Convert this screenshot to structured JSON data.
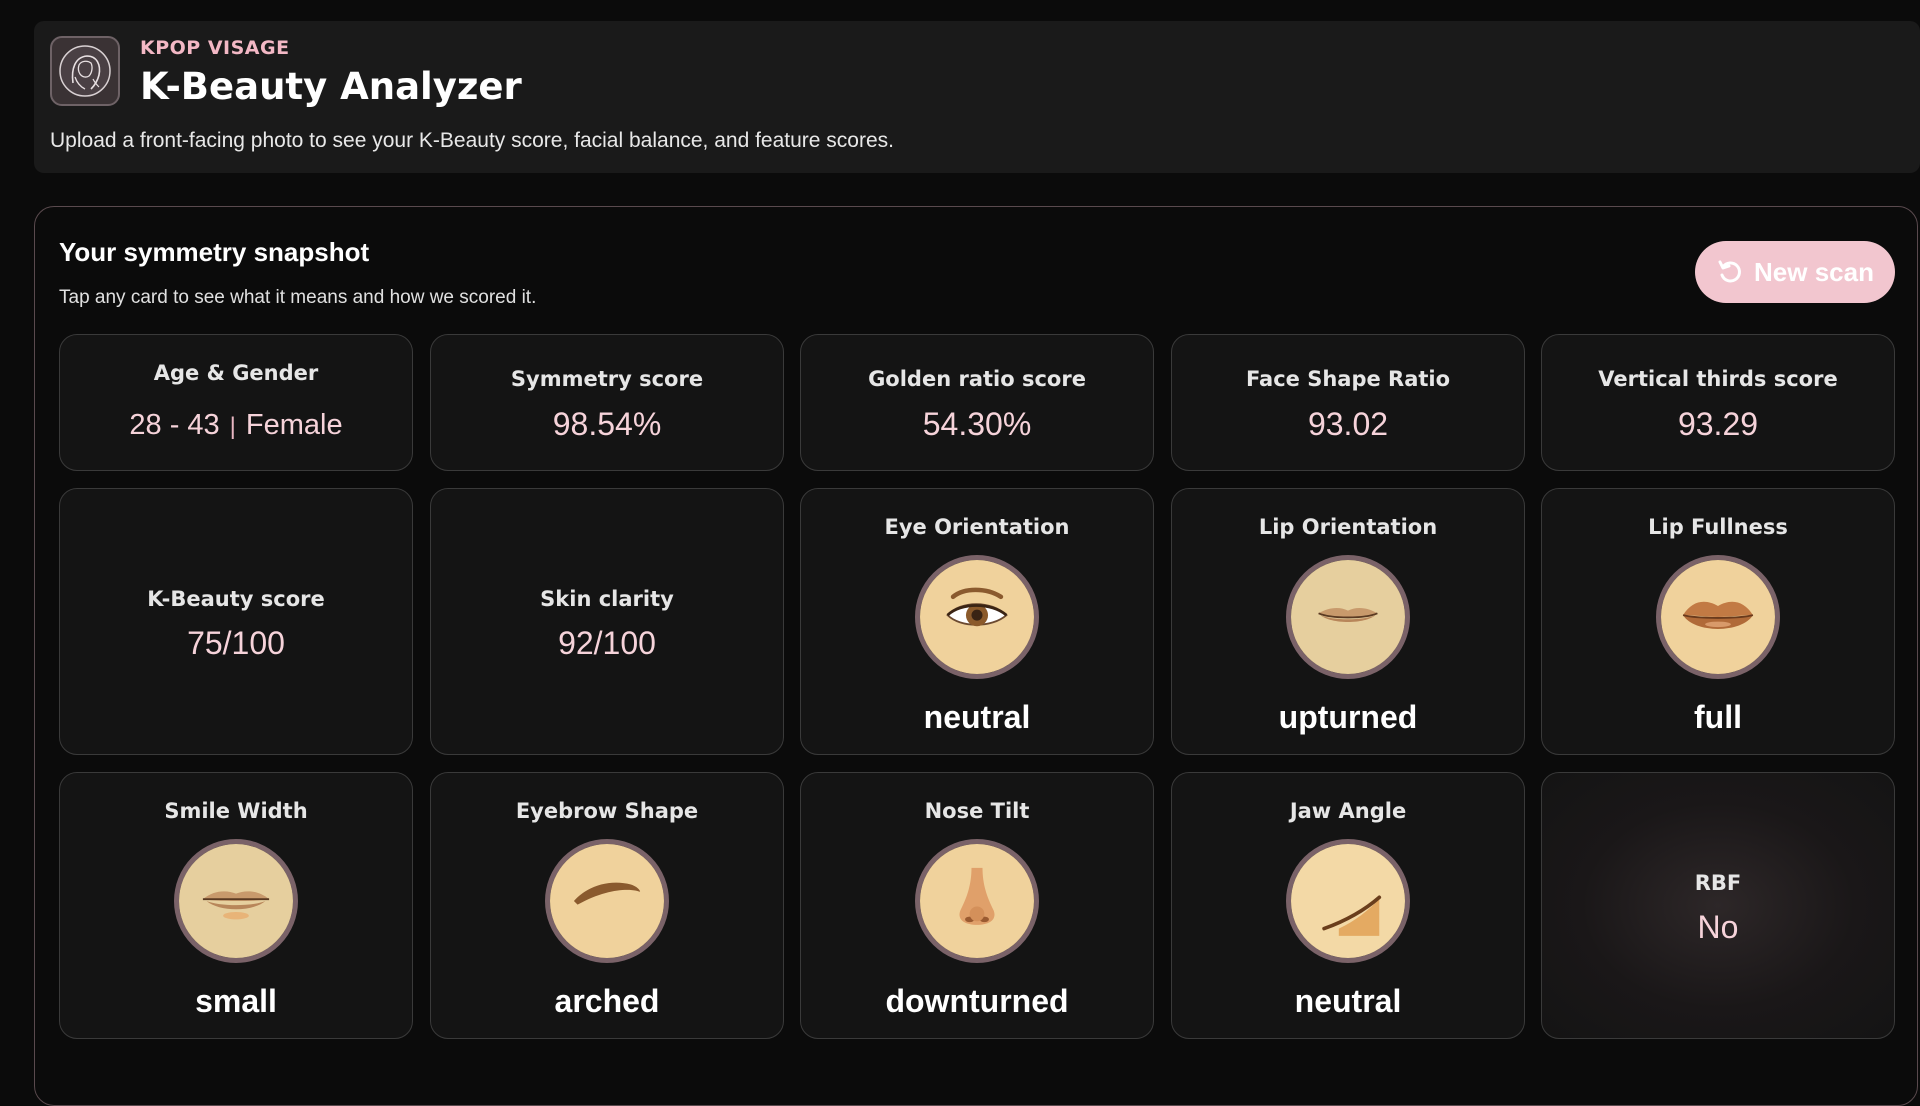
{
  "header": {
    "brand": "KPOP VISAGE",
    "title": "K-Beauty Analyzer",
    "tagline": "Upload a front-facing photo to see your K-Beauty score, facial balance, and feature scores.",
    "logo_icon": "woman-portrait-icon"
  },
  "snapshot": {
    "title": "Your symmetry snapshot",
    "subtitle": "Tap any card to see what it means and how we scored it.",
    "new_scan_label": "New scan",
    "new_scan_icon": "refresh-icon"
  },
  "cards": {
    "age_gender": {
      "label": "Age & Gender",
      "age": "28 - 43",
      "separator": "|",
      "gender": "Female"
    },
    "symmetry": {
      "label": "Symmetry score",
      "value": "98.54%"
    },
    "golden_ratio": {
      "label": "Golden ratio score",
      "value": "54.30%"
    },
    "face_shape": {
      "label": "Face Shape Ratio",
      "value": "93.02"
    },
    "vertical_thirds": {
      "label": "Vertical thirds score",
      "value": "93.29"
    },
    "kbeauty": {
      "label": "K-Beauty score",
      "value": "75/100"
    },
    "skin_clarity": {
      "label": "Skin clarity",
      "value": "92/100"
    },
    "eye_orientation": {
      "label": "Eye Orientation",
      "value": "neutral",
      "icon": "eye-icon"
    },
    "lip_orientation": {
      "label": "Lip Orientation",
      "value": "upturned",
      "icon": "lips-upturned-icon"
    },
    "lip_fullness": {
      "label": "Lip Fullness",
      "value": "full",
      "icon": "full-lips-icon"
    },
    "smile_width": {
      "label": "Smile Width",
      "value": "small",
      "icon": "small-smile-icon"
    },
    "eyebrow_shape": {
      "label": "Eyebrow Shape",
      "value": "arched",
      "icon": "arched-eyebrow-icon"
    },
    "nose_tilt": {
      "label": "Nose Tilt",
      "value": "downturned",
      "icon": "nose-icon"
    },
    "jaw_angle": {
      "label": "Jaw Angle",
      "value": "neutral",
      "icon": "jaw-icon"
    },
    "rbf": {
      "label": "RBF",
      "value": "No"
    }
  },
  "colors": {
    "accent_pink": "#f2c6cf",
    "brand_pink": "#f3b8c5",
    "value_pink": "#f6d3da",
    "card_bg": "#141414",
    "skin_tone": "#f0d29c"
  }
}
